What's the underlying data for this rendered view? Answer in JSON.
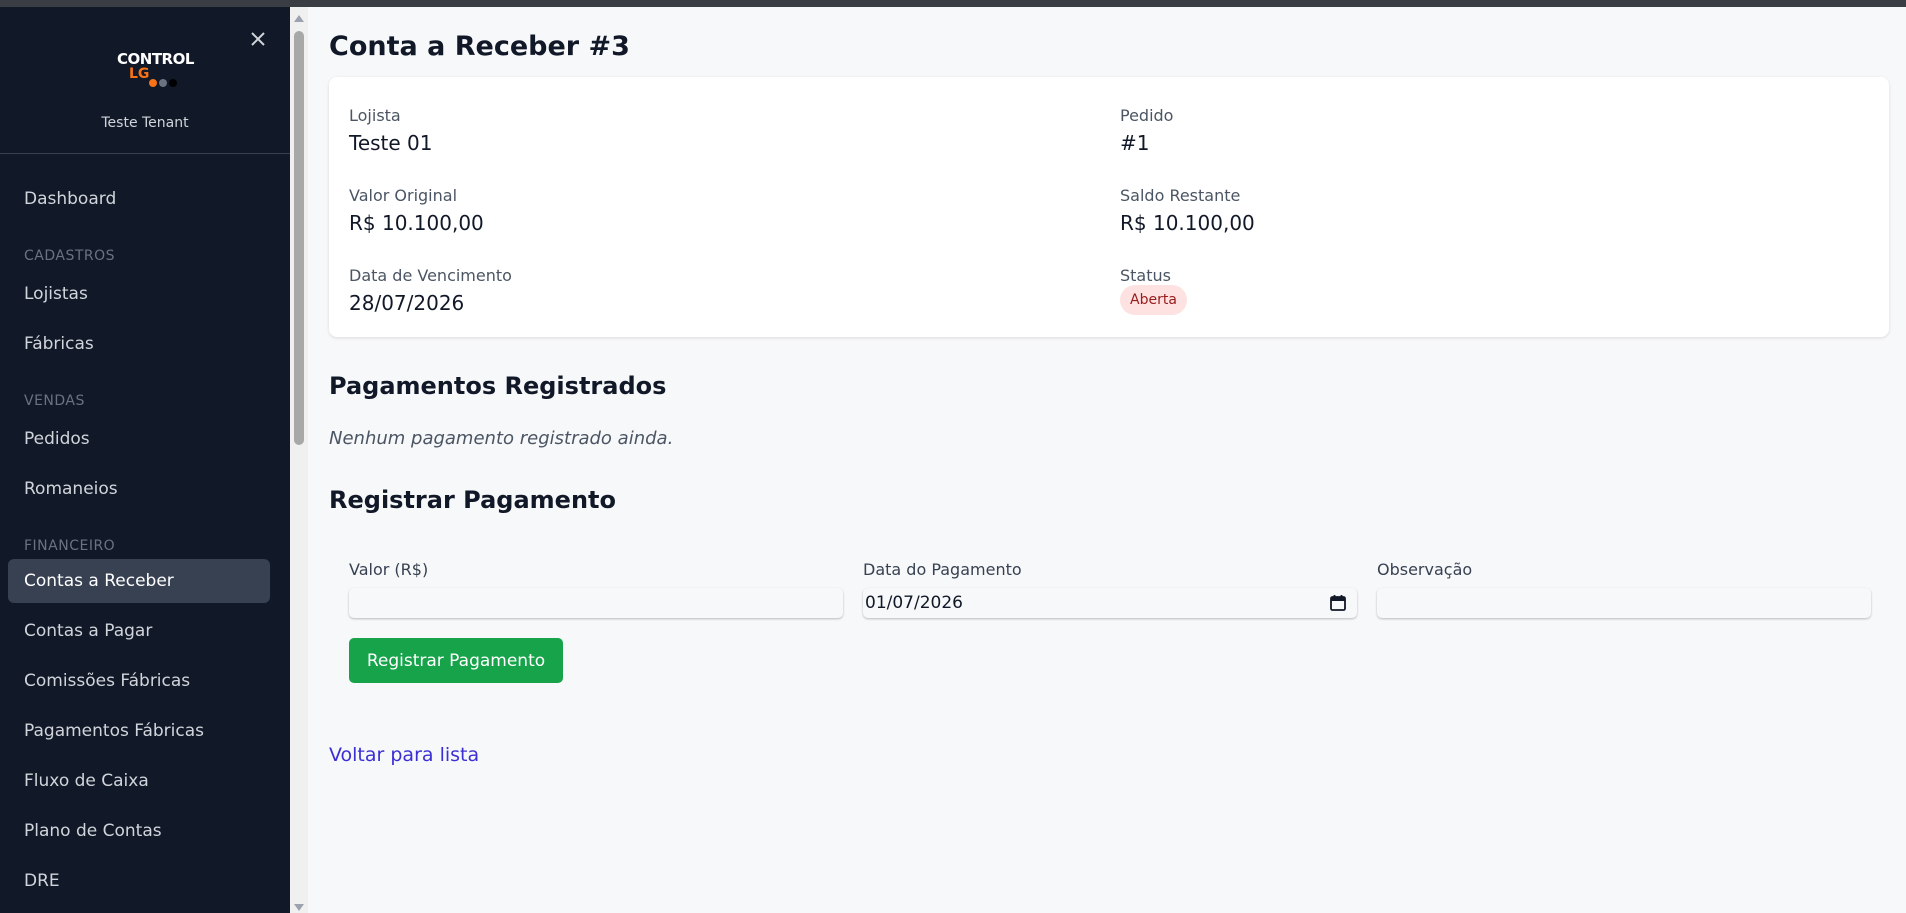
{
  "sidebar": {
    "brand": {
      "line1": "CONTROL",
      "line2": "LG"
    },
    "tenant": "Teste Tenant",
    "dashboard": "Dashboard",
    "sections": {
      "cadastros": "CADASTROS",
      "vendas": "VENDAS",
      "financeiro": "FINANCEIRO"
    },
    "items": {
      "lojistas": "Lojistas",
      "fabricas": "Fábricas",
      "pedidos": "Pedidos",
      "romaneios": "Romaneios",
      "contas_receber": "Contas a Receber",
      "contas_pagar": "Contas a Pagar",
      "comissoes": "Comissões Fábricas",
      "pagamentos": "Pagamentos Fábricas",
      "fluxo": "Fluxo de Caixa",
      "plano": "Plano de Contas",
      "dre": "DRE"
    }
  },
  "page": {
    "title": "Conta a Receber #3"
  },
  "details": {
    "lojista": {
      "label": "Lojista",
      "value": "Teste 01"
    },
    "pedido": {
      "label": "Pedido",
      "value": "#1"
    },
    "valor_original": {
      "label": "Valor Original",
      "value": "R$ 10.100,00"
    },
    "saldo_restante": {
      "label": "Saldo Restante",
      "value": "R$ 10.100,00"
    },
    "vencimento": {
      "label": "Data de Vencimento",
      "value": "28/07/2026"
    },
    "status": {
      "label": "Status",
      "value": "Aberta"
    }
  },
  "payments": {
    "title": "Pagamentos Registrados",
    "empty": "Nenhum pagamento registrado ainda."
  },
  "form": {
    "title": "Registrar Pagamento",
    "valor_label": "Valor (R$)",
    "valor_value": "",
    "data_label": "Data do Pagamento",
    "data_value": "01/07/2026",
    "obs_label": "Observação",
    "obs_value": "",
    "submit": "Registrar Pagamento"
  },
  "back_link": "Voltar para lista",
  "colors": {
    "sidebar_bg": "#111827",
    "active_item_bg": "#374151",
    "submit_green": "#16a34a",
    "badge_bg": "#fee2e2",
    "badge_text": "#991b1b",
    "link": "#3b2fd3"
  }
}
